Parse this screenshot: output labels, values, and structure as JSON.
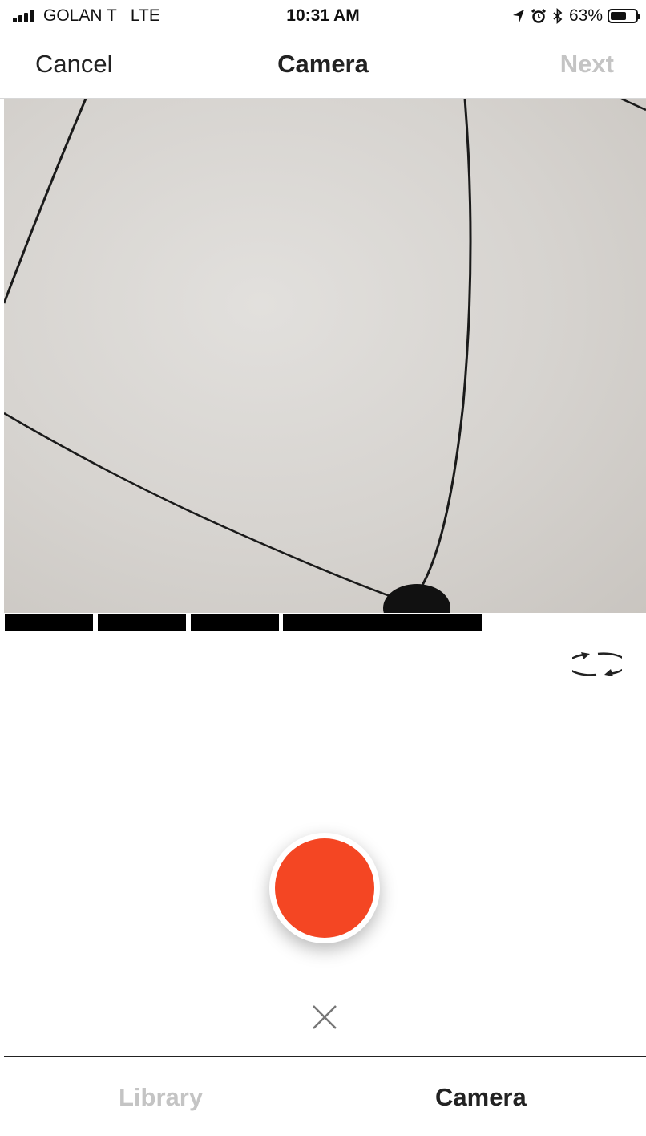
{
  "status_bar": {
    "carrier": "GOLAN T   LTE",
    "time": "10:31 AM",
    "battery_percent": "63%",
    "battery_level": 0.63,
    "icons": [
      "signal-bars-icon",
      "location-arrow-icon",
      "alarm-icon",
      "bluetooth-icon",
      "battery-icon"
    ]
  },
  "nav": {
    "cancel_label": "Cancel",
    "title": "Camera",
    "next_label": "Next"
  },
  "recording": {
    "segment_count": 4
  },
  "controls": {
    "flip_icon": "camera-flip-icon",
    "shutter_color": "#f44623",
    "discard_icon": "close-icon"
  },
  "tabs": [
    {
      "label": "Library",
      "active": false
    },
    {
      "label": "Camera",
      "active": true
    }
  ],
  "colors": {
    "accent": "#f44623",
    "inactive_text": "#c4c4c4",
    "text": "#222222"
  }
}
